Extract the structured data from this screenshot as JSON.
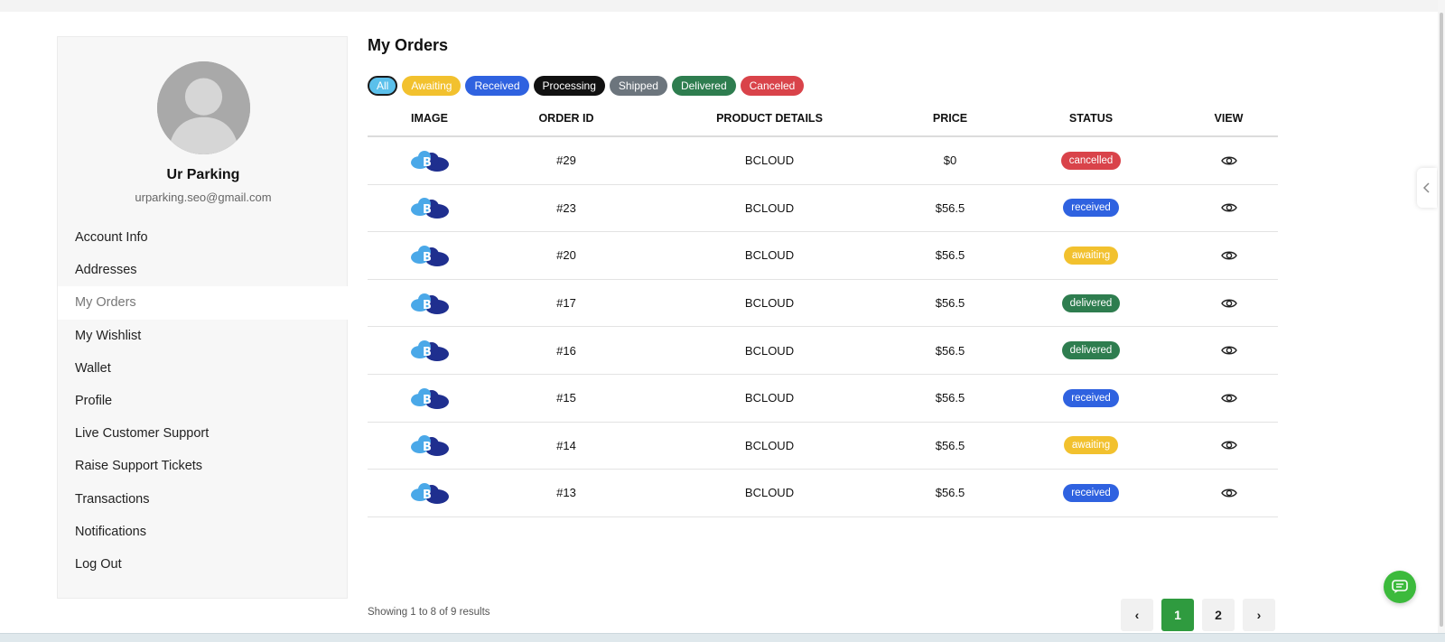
{
  "sidebar": {
    "user_name": "Ur Parking",
    "user_email": "urparking.seo@gmail.com",
    "items": [
      {
        "label": "Account Info",
        "active": false
      },
      {
        "label": "Addresses",
        "active": false
      },
      {
        "label": "My Orders",
        "active": true
      },
      {
        "label": "My Wishlist",
        "active": false
      },
      {
        "label": "Wallet",
        "active": false
      },
      {
        "label": "Profile",
        "active": false
      },
      {
        "label": "Live Customer Support",
        "active": false
      },
      {
        "label": "Raise Support Tickets",
        "active": false
      },
      {
        "label": "Transactions",
        "active": false
      },
      {
        "label": "Notifications",
        "active": false
      },
      {
        "label": "Log Out",
        "active": false
      }
    ]
  },
  "main": {
    "title": "My Orders",
    "filters": [
      {
        "label": "All",
        "key": "all",
        "selected": true
      },
      {
        "label": "Awaiting",
        "key": "awaiting"
      },
      {
        "label": "Received",
        "key": "received"
      },
      {
        "label": "Processing",
        "key": "processing"
      },
      {
        "label": "Shipped",
        "key": "shipped"
      },
      {
        "label": "Delivered",
        "key": "delivered"
      },
      {
        "label": "Canceled",
        "key": "canceled"
      }
    ],
    "table": {
      "headers": {
        "image": "IMAGE",
        "order_id": "ORDER ID",
        "product_details": "PRODUCT DETAILS",
        "price": "PRICE",
        "status": "STATUS",
        "view": "VIEW"
      },
      "rows": [
        {
          "order_id": "#29",
          "product": "BCLOUD",
          "price": "$0",
          "status": "cancelled"
        },
        {
          "order_id": "#23",
          "product": "BCLOUD",
          "price": "$56.5",
          "status": "received"
        },
        {
          "order_id": "#20",
          "product": "BCLOUD",
          "price": "$56.5",
          "status": "awaiting"
        },
        {
          "order_id": "#17",
          "product": "BCLOUD",
          "price": "$56.5",
          "status": "delivered"
        },
        {
          "order_id": "#16",
          "product": "BCLOUD",
          "price": "$56.5",
          "status": "delivered"
        },
        {
          "order_id": "#15",
          "product": "BCLOUD",
          "price": "$56.5",
          "status": "received"
        },
        {
          "order_id": "#14",
          "product": "BCLOUD",
          "price": "$56.5",
          "status": "awaiting"
        },
        {
          "order_id": "#13",
          "product": "BCLOUD",
          "price": "$56.5",
          "status": "received"
        }
      ]
    },
    "showing": "Showing 1 to 8 of 9 results",
    "pagination": {
      "prev_label": "‹",
      "pages": [
        "1",
        "2"
      ],
      "current": "1",
      "next_label": "›"
    }
  },
  "icons": {
    "avatar": "user-silhouette-icon",
    "product_image": "bcloud-logo",
    "view": "eye-icon",
    "side_tab": "chevron-left-icon",
    "chat": "chat-bubble-icon"
  },
  "colors": {
    "all": "#5bc0eb",
    "awaiting": "#f2c12e",
    "received": "#2f62e0",
    "processing": "#111111",
    "shipped": "#6c757d",
    "delivered": "#2e7d4f",
    "canceled": "#d9434a",
    "pagination_active": "#2f9b3f",
    "chat_button": "#3cba3c"
  }
}
